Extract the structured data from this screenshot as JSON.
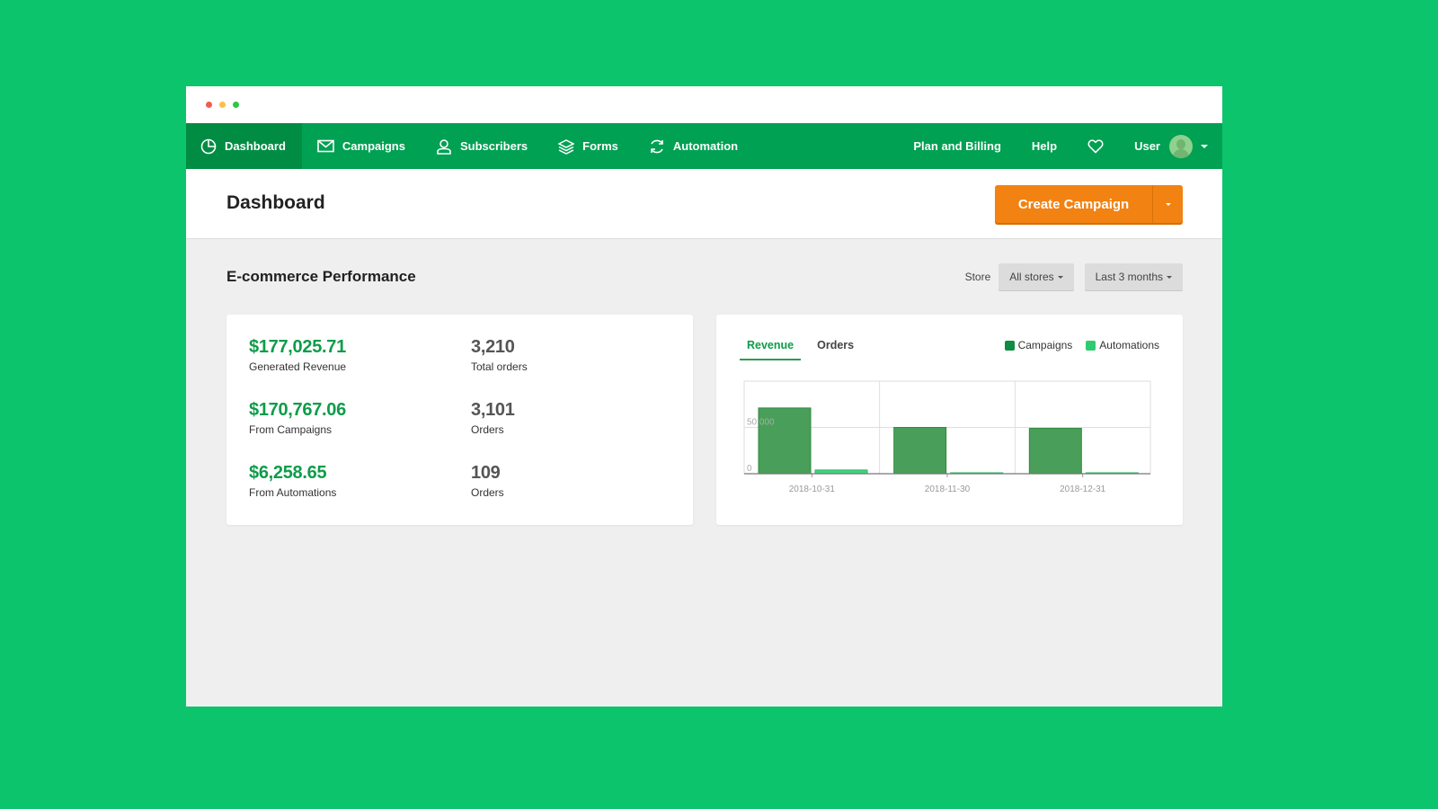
{
  "window": {
    "controls": [
      "close",
      "minimize",
      "maximize"
    ]
  },
  "nav": {
    "items": [
      {
        "label": "Dashboard",
        "icon": "pie-chart-icon",
        "active": true
      },
      {
        "label": "Campaigns",
        "icon": "envelope-icon",
        "active": false
      },
      {
        "label": "Subscribers",
        "icon": "user-icon",
        "active": false
      },
      {
        "label": "Forms",
        "icon": "layers-icon",
        "active": false
      },
      {
        "label": "Automation",
        "icon": "refresh-icon",
        "active": false
      }
    ],
    "right": {
      "plan_billing": "Plan and Billing",
      "help": "Help",
      "favorites_icon": "heart-icon",
      "user": "User"
    }
  },
  "header": {
    "title": "Dashboard",
    "create_button": "Create Campaign"
  },
  "section": {
    "title": "E-commerce Performance",
    "store_label": "Store",
    "store_select": "All stores",
    "period_select": "Last 3 months"
  },
  "stats": [
    {
      "value": "$177,025.71",
      "label": "Generated Revenue",
      "type": "money"
    },
    {
      "value": "3,210",
      "label": "Total orders",
      "type": "count"
    },
    {
      "value": "$170,767.06",
      "label": "From Campaigns",
      "type": "money"
    },
    {
      "value": "3,101",
      "label": "Orders",
      "type": "count"
    },
    {
      "value": "$6,258.65",
      "label": "From Automations",
      "type": "money"
    },
    {
      "value": "109",
      "label": "Orders",
      "type": "count"
    }
  ],
  "chart_tabs": [
    {
      "label": "Revenue",
      "active": true
    },
    {
      "label": "Orders",
      "active": false
    }
  ],
  "colors": {
    "brand": "#00a152",
    "accent": "#f28211",
    "campaigns": "#4a9e5a",
    "automations": "#2ecc71"
  },
  "chart_data": {
    "type": "bar",
    "title": "Revenue",
    "categories": [
      "2018-10-31",
      "2018-11-30",
      "2018-12-31"
    ],
    "series": [
      {
        "name": "Campaigns",
        "values": [
          71000,
          50000,
          49000
        ]
      },
      {
        "name": "Automations",
        "values": [
          4000,
          1000,
          1000
        ]
      }
    ],
    "yticks": [
      0,
      50000
    ],
    "ytick_labels": [
      "0",
      "50,000"
    ],
    "ylim": [
      0,
      100000
    ],
    "xlabel": "",
    "ylabel": "",
    "grid": true,
    "legend": "top-right"
  }
}
